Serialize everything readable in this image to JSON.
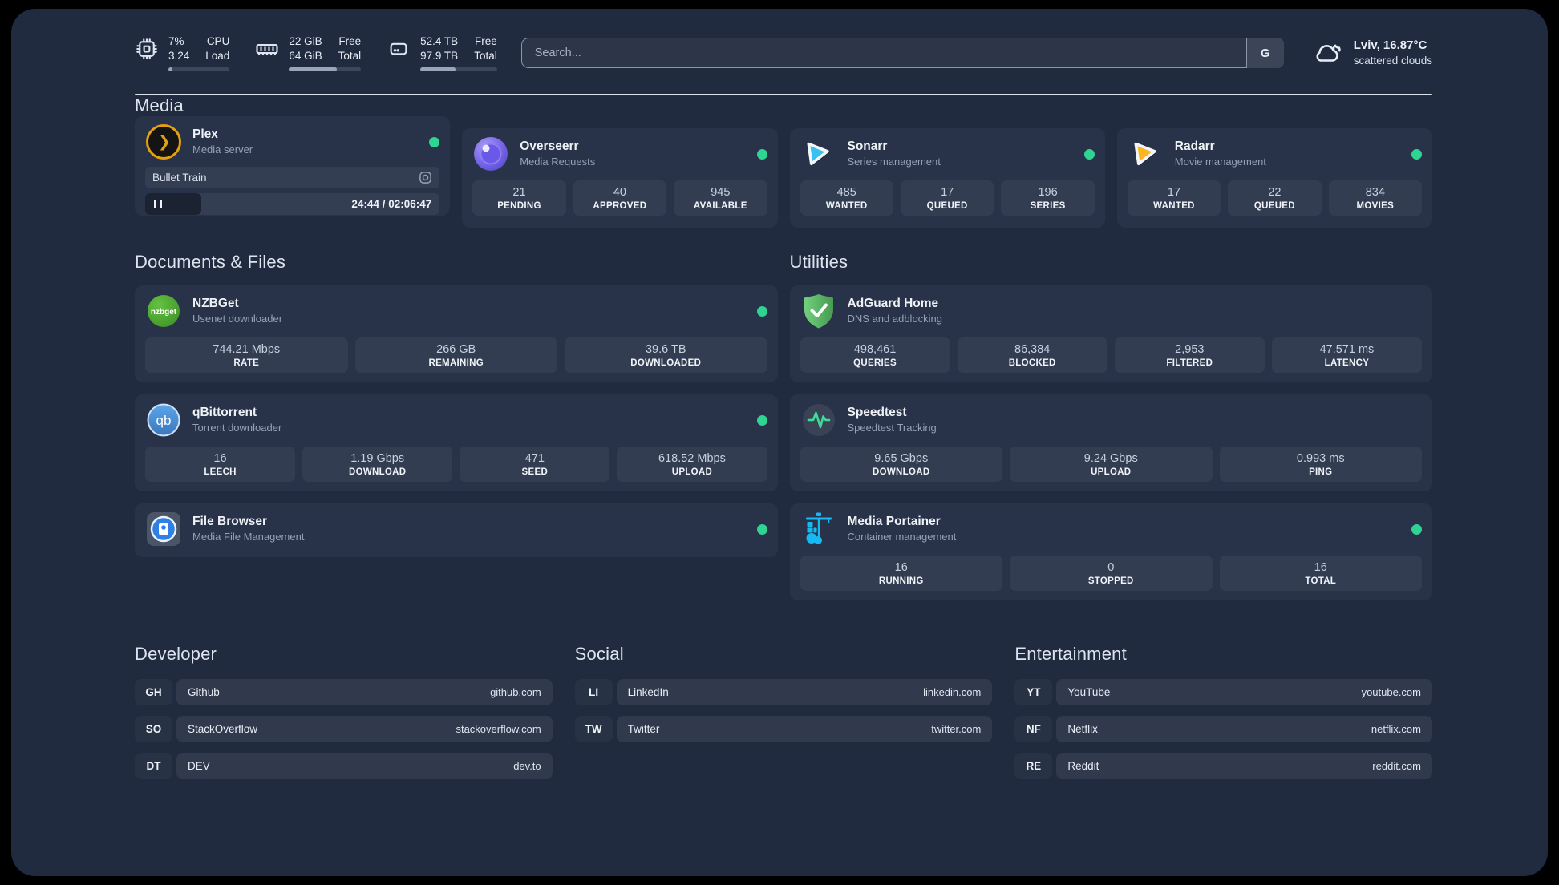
{
  "header": {
    "resources": [
      {
        "kind": "cpu",
        "values": [
          "7%",
          "3.24"
        ],
        "labels": [
          "CPU",
          "Load"
        ],
        "progress": 7
      },
      {
        "kind": "memory",
        "values": [
          "22 GiB",
          "64 GiB"
        ],
        "labels": [
          "Free",
          "Total"
        ],
        "progress": 66
      },
      {
        "kind": "disk",
        "values": [
          "52.4 TB",
          "97.9 TB"
        ],
        "labels": [
          "Free",
          "Total"
        ],
        "progress": 46
      }
    ],
    "search": {
      "placeholder": "Search...",
      "provider_button": "G"
    },
    "weather": {
      "location": "Lviv, 16.87°C",
      "condition": "scattered clouds"
    }
  },
  "media": {
    "heading": "Media",
    "cards": [
      {
        "title": "Plex",
        "subtitle": "Media server",
        "status": "online",
        "now_playing": {
          "title": "Bullet Train",
          "time": "24:44 / 02:06:47",
          "progress": 19,
          "state": "paused"
        }
      },
      {
        "title": "Overseerr",
        "subtitle": "Media Requests",
        "status": "online",
        "stats": [
          {
            "value": "21",
            "label": "PENDING"
          },
          {
            "value": "40",
            "label": "APPROVED"
          },
          {
            "value": "945",
            "label": "AVAILABLE"
          }
        ]
      },
      {
        "title": "Sonarr",
        "subtitle": "Series management",
        "status": "online",
        "stats": [
          {
            "value": "485",
            "label": "WANTED"
          },
          {
            "value": "17",
            "label": "QUEUED"
          },
          {
            "value": "196",
            "label": "SERIES"
          }
        ]
      },
      {
        "title": "Radarr",
        "subtitle": "Movie management",
        "status": "online",
        "stats": [
          {
            "value": "17",
            "label": "WANTED"
          },
          {
            "value": "22",
            "label": "QUEUED"
          },
          {
            "value": "834",
            "label": "MOVIES"
          }
        ]
      }
    ]
  },
  "documents": {
    "heading": "Documents & Files",
    "cards": [
      {
        "title": "NZBGet",
        "subtitle": "Usenet downloader",
        "status": "online",
        "stats": [
          {
            "value": "744.21 Mbps",
            "label": "RATE"
          },
          {
            "value": "266 GB",
            "label": "REMAINING"
          },
          {
            "value": "39.6 TB",
            "label": "DOWNLOADED"
          }
        ]
      },
      {
        "title": "qBittorrent",
        "subtitle": "Torrent downloader",
        "status": "online",
        "stats": [
          {
            "value": "16",
            "label": "LEECH"
          },
          {
            "value": "1.19 Gbps",
            "label": "DOWNLOAD"
          },
          {
            "value": "471",
            "label": "SEED"
          },
          {
            "value": "618.52 Mbps",
            "label": "UPLOAD"
          }
        ]
      },
      {
        "title": "File Browser",
        "subtitle": "Media File Management",
        "status": "online"
      }
    ]
  },
  "utilities": {
    "heading": "Utilities",
    "cards": [
      {
        "title": "AdGuard Home",
        "subtitle": "DNS and adblocking",
        "stats": [
          {
            "value": "498,461",
            "label": "QUERIES"
          },
          {
            "value": "86,384",
            "label": "BLOCKED"
          },
          {
            "value": "2,953",
            "label": "FILTERED"
          },
          {
            "value": "47.571 ms",
            "label": "LATENCY"
          }
        ]
      },
      {
        "title": "Speedtest",
        "subtitle": "Speedtest Tracking",
        "stats": [
          {
            "value": "9.65 Gbps",
            "label": "DOWNLOAD"
          },
          {
            "value": "9.24 Gbps",
            "label": "UPLOAD"
          },
          {
            "value": "0.993 ms",
            "label": "PING"
          }
        ]
      },
      {
        "title": "Media Portainer",
        "subtitle": "Container management",
        "status": "online",
        "stats": [
          {
            "value": "16",
            "label": "RUNNING"
          },
          {
            "value": "0",
            "label": "STOPPED"
          },
          {
            "value": "16",
            "label": "TOTAL"
          }
        ]
      }
    ]
  },
  "bookmarks": {
    "groups": [
      {
        "heading": "Developer",
        "links": [
          {
            "abbr": "GH",
            "name": "Github",
            "url": "github.com"
          },
          {
            "abbr": "SO",
            "name": "StackOverflow",
            "url": "stackoverflow.com"
          },
          {
            "abbr": "DT",
            "name": "DEV",
            "url": "dev.to"
          }
        ]
      },
      {
        "heading": "Social",
        "links": [
          {
            "abbr": "LI",
            "name": "LinkedIn",
            "url": "linkedin.com"
          },
          {
            "abbr": "TW",
            "name": "Twitter",
            "url": "twitter.com"
          }
        ]
      },
      {
        "heading": "Entertainment",
        "links": [
          {
            "abbr": "YT",
            "name": "YouTube",
            "url": "youtube.com"
          },
          {
            "abbr": "NF",
            "name": "Netflix",
            "url": "netflix.com"
          },
          {
            "abbr": "RE",
            "name": "Reddit",
            "url": "reddit.com"
          }
        ]
      }
    ]
  },
  "colors": {
    "status_online": "#2fd492",
    "page_bg": "#212b3f",
    "accent_plex": "#e5a00d"
  }
}
